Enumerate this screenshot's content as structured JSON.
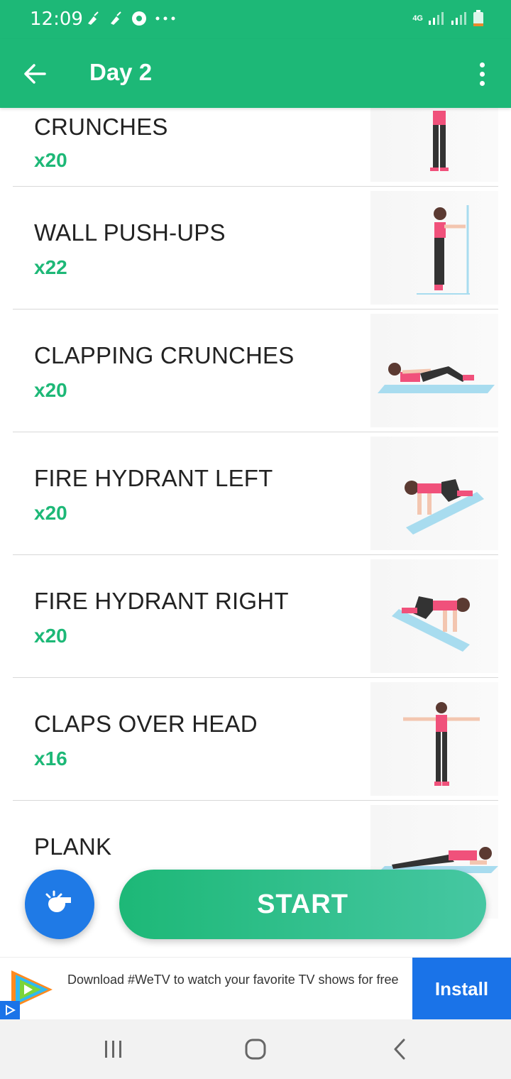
{
  "status": {
    "time": "12:09",
    "network": "4G",
    "left_icons": [
      "broom-icon",
      "broom-icon",
      "chrome-icon",
      "more-dots-icon"
    ],
    "right_icons": [
      "signal-icon",
      "signal-icon",
      "battery-icon"
    ]
  },
  "appbar": {
    "title": "Day 2",
    "back_icon": "arrow-left-icon",
    "menu_icon": "more-vert-icon"
  },
  "exercises": [
    {
      "name": "CRUNCHES",
      "reps": "x20",
      "image": "standing-figure"
    },
    {
      "name": "WALL PUSH-UPS",
      "reps": "x22",
      "image": "wall-pushup-figure"
    },
    {
      "name": "CLAPPING CRUNCHES",
      "reps": "x20",
      "image": "lying-figure"
    },
    {
      "name": "FIRE HYDRANT LEFT",
      "reps": "x20",
      "image": "kneeling-figure"
    },
    {
      "name": "FIRE HYDRANT RIGHT",
      "reps": "x20",
      "image": "kneeling-figure"
    },
    {
      "name": "CLAPS OVER HEAD",
      "reps": "x16",
      "image": "arms-out-figure"
    },
    {
      "name": "PLANK",
      "reps": "",
      "image": "plank-figure"
    }
  ],
  "actions": {
    "coach_icon": "whistle-icon",
    "start_label": "START"
  },
  "ad": {
    "text": "Download #WeTV to watch your favorite TV shows for free",
    "install_label": "Install",
    "logo_icon": "wetv-logo-icon",
    "badge_icon": "ad-choices-icon"
  },
  "navbar": {
    "recents_icon": "recents-icon",
    "home_icon": "home-icon",
    "back_icon": "nav-back-icon"
  },
  "colors": {
    "primary": "#1db877",
    "fab": "#1f7ae6",
    "install": "#1a73e8",
    "shirt": "#f0517b"
  }
}
